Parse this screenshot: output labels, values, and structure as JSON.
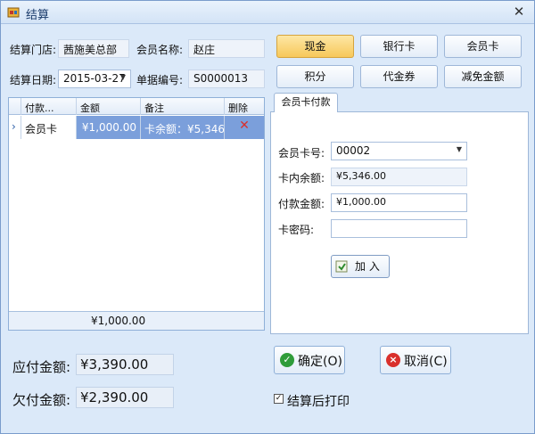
{
  "window": {
    "title": "结算"
  },
  "form": {
    "store_label": "结算门店:",
    "store_value": "茜施美总部",
    "member_name_label": "会员名称:",
    "member_name_value": "赵庄",
    "date_label": "结算日期:",
    "date_value": "2015-03-27",
    "doc_no_label": "单据编号:",
    "doc_no_value": "S0000013"
  },
  "grid": {
    "columns": [
      "付款...",
      "金额",
      "备注",
      "删除"
    ],
    "rows": [
      {
        "method": "会员卡",
        "amount": "¥1,000.00",
        "note": "卡余额：¥5,346...."
      }
    ],
    "footer_total": "¥1,000.00"
  },
  "payment_buttons": {
    "cash": "现金",
    "bank_card": "银行卡",
    "member_card": "会员卡",
    "points": "积分",
    "voucher": "代金券",
    "discount": "减免金额"
  },
  "tab": {
    "label": "会员卡付款"
  },
  "card_form": {
    "card_no_label": "会员卡号:",
    "card_no_value": "00002",
    "balance_label": "卡内余额:",
    "balance_value": "¥5,346.00",
    "pay_amount_label": "付款金额:",
    "pay_amount_value": "¥1,000.00",
    "password_label": "卡密码:",
    "password_value": "",
    "add_button": "加 入"
  },
  "summary": {
    "payable_label": "应付金额:",
    "payable_value": "¥3,390.00",
    "owed_label": "欠付金额:",
    "owed_value": "¥2,390.00"
  },
  "actions": {
    "confirm": "确定(O)",
    "cancel": "取消(C)",
    "print_after": "结算后打印"
  },
  "colors": {
    "active_button": "#f7c85a",
    "selected_row": "#7b9fdb",
    "delete_icon": "#d9302c"
  }
}
